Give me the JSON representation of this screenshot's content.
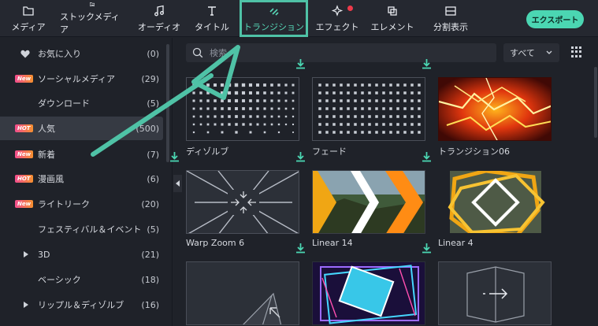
{
  "toolbar": {
    "items": [
      {
        "label": "メディア",
        "icon": "folder-icon"
      },
      {
        "label": "ストックメディア",
        "icon": "stock-media-icon"
      },
      {
        "label": "オーディオ",
        "icon": "music-note-icon"
      },
      {
        "label": "タイトル",
        "icon": "title-t-icon"
      },
      {
        "label": "トランジション",
        "icon": "transition-icon"
      },
      {
        "label": "エフェクト",
        "icon": "effect-icon"
      },
      {
        "label": "エレメント",
        "icon": "element-icon"
      },
      {
        "label": "分割表示",
        "icon": "split-screen-icon"
      }
    ],
    "active": "トランジション",
    "export_label": "エクスポート",
    "accent": "#4bd6b2",
    "notify_color": "#ee3a4a"
  },
  "sidebar": {
    "items": [
      {
        "label": "お気に入り",
        "count": "(0)",
        "lead": "heart-icon"
      },
      {
        "label": "ソーシャルメディア",
        "count": "(29)",
        "badge": "New"
      },
      {
        "label": "ダウンロード",
        "count": "(5)"
      },
      {
        "label": "人気",
        "count": "(500)",
        "badge": "HOT",
        "selected": true
      },
      {
        "label": "新着",
        "count": "(7)",
        "badge": "New"
      },
      {
        "label": "漫画風",
        "count": "(6)",
        "badge": "HOT"
      },
      {
        "label": "ライトリーク",
        "count": "(20)",
        "badge": "New"
      },
      {
        "label": "フェスティバル＆イベント",
        "count": "(5)"
      },
      {
        "label": "3D",
        "count": "(21)",
        "expandable": true
      },
      {
        "label": "ベーシック",
        "count": "(18)"
      },
      {
        "label": "リップル＆ディゾルブ",
        "count": "(16)",
        "expandable": true
      }
    ]
  },
  "search": {
    "placeholder": "検索"
  },
  "filter": {
    "selected": "すべて"
  },
  "tiles": [
    {
      "label": "ディゾルブ",
      "thumb": "dissolve-dots",
      "download": false
    },
    {
      "label": "フェード",
      "thumb": "fade-dots",
      "download": true
    },
    {
      "label": "トランジション06",
      "thumb": "fire-lightning",
      "download": true
    },
    {
      "label": "Warp Zoom 6",
      "thumb": "warp-zoom-lines",
      "download": true
    },
    {
      "label": "Linear 14",
      "thumb": "linear-chevrons",
      "download": true
    },
    {
      "label": "Linear 4",
      "thumb": "linear-diamond",
      "download": true
    },
    {
      "label": "",
      "thumb": "page-curl",
      "download": false
    },
    {
      "label": "",
      "thumb": "neon-frames",
      "download": true
    },
    {
      "label": "",
      "thumb": "cube-arrow",
      "download": true
    }
  ]
}
